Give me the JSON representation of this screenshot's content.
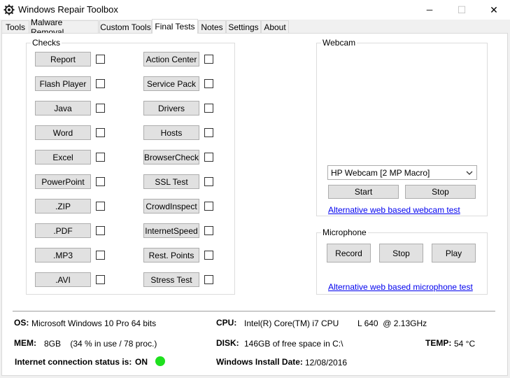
{
  "window": {
    "title": "Windows Repair Toolbox",
    "minimize": "─",
    "maximize": "☐",
    "close": "✕"
  },
  "tabs": [
    {
      "label": "Tools"
    },
    {
      "label": "Malware Removal"
    },
    {
      "label": "Custom Tools"
    },
    {
      "label": "Final Tests",
      "active": true
    },
    {
      "label": "Notes"
    },
    {
      "label": "Settings"
    },
    {
      "label": "About"
    }
  ],
  "checks": {
    "title": "Checks",
    "left": [
      "Report",
      "Flash Player",
      "Java",
      "Word",
      "Excel",
      "PowerPoint",
      ".ZIP",
      ".PDF",
      ".MP3",
      ".AVI"
    ],
    "right": [
      "Action Center",
      "Service Pack",
      "Drivers",
      "Hosts",
      "BrowserCheck",
      "SSL Test",
      "CrowdInspect",
      "InternetSpeed",
      "Rest. Points",
      "Stress Test"
    ]
  },
  "webcam": {
    "title": "Webcam",
    "device": "HP Webcam [2 MP Macro]",
    "start": "Start",
    "stop": "Stop",
    "alt_link": "Alternative web based webcam test"
  },
  "microphone": {
    "title": "Microphone",
    "record": "Record",
    "stop": "Stop",
    "play": "Play",
    "alt_link": "Alternative web based microphone test"
  },
  "sysinfo": {
    "os_label": "OS:",
    "os_value": "Microsoft Windows 10 Pro 64 bits",
    "cpu_label": "CPU:",
    "cpu_value": "Intel(R) Core(TM) i7 CPU        L 640  @ 2.13GHz",
    "mem_label": "MEM:",
    "mem_value": "8GB    (34 % in use / 78 proc.)",
    "disk_label": "DISK:",
    "disk_value": "146GB of free space in C:\\",
    "temp_label": "TEMP:",
    "temp_value": "54 °C",
    "internet_label": "Internet connection status is:",
    "internet_value": "ON",
    "install_label": "Windows Install Date:",
    "install_value": "12/08/2016"
  },
  "colors": {
    "status_on": "#1ee01e",
    "link": "#0000ee"
  }
}
